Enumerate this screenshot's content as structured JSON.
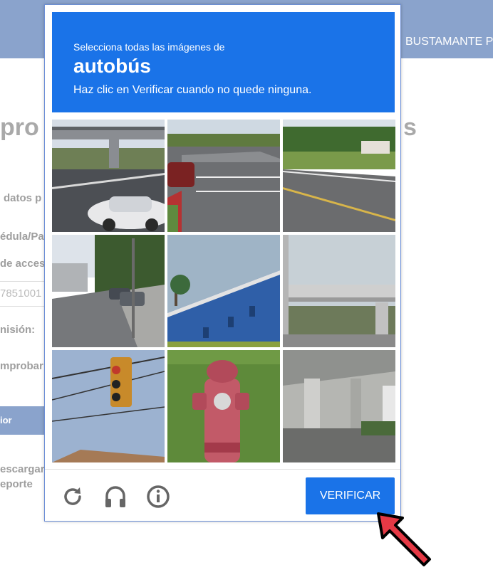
{
  "background_page": {
    "user_name": "BUSTAMANTE P",
    "title_left": "pro",
    "title_right": "s",
    "labels": [
      "datos p",
      "édula/Pa",
      "de acces",
      "nisión:",
      "mprobar"
    ],
    "input_value": "7851001",
    "button_label": "ior",
    "download_lines": [
      "escargar",
      "eporte"
    ]
  },
  "captcha": {
    "instruction_line1": "Selecciona todas las imágenes de",
    "target_object": "autobús",
    "instruction_line2": "Haz clic en Verificar cuando no quede ninguna.",
    "verify_label": "VERIFICAR",
    "tiles": [
      {
        "name": "overpass-with-white-car"
      },
      {
        "name": "parking-lot-road"
      },
      {
        "name": "empty-road"
      },
      {
        "name": "street-with-parked-cars"
      },
      {
        "name": "blue-building-wall"
      },
      {
        "name": "highway-overpass"
      },
      {
        "name": "traffic-light"
      },
      {
        "name": "red-fire-hydrant"
      },
      {
        "name": "under-bridge"
      }
    ],
    "footer_icons": [
      "reload-icon",
      "headphones-icon",
      "info-icon"
    ],
    "accent_color": "#1a73e8"
  }
}
